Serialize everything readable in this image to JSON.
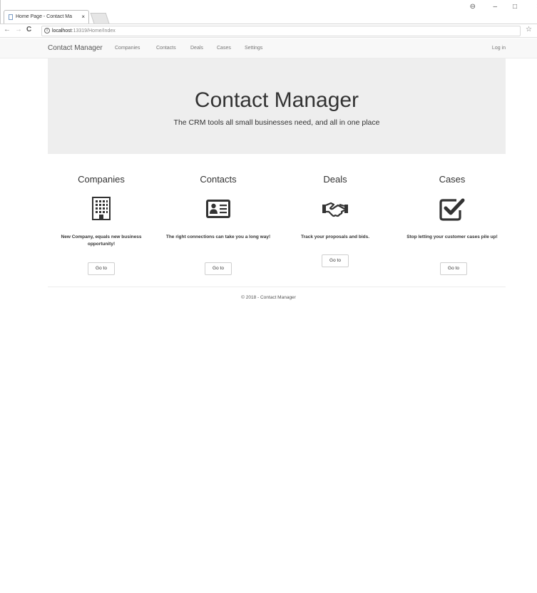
{
  "browser": {
    "tab_title": "Home Page - Contact Ma",
    "tab_close": "×",
    "url_host": "localhost",
    "url_rest": ":13319/Home/Index",
    "back": "←",
    "forward": "→",
    "reload": "C",
    "star": "☆",
    "win_account": "⊖",
    "win_min": "–",
    "win_max": "□",
    "win_close": "×"
  },
  "nav": {
    "brand": "Contact Manager",
    "links": [
      "Companies",
      "Contacts",
      "Deals",
      "Cases",
      "Settings"
    ],
    "login": "Log in"
  },
  "jumbotron": {
    "title": "Contact Manager",
    "subtitle": "The CRM tools all small businesses need, and all in one place"
  },
  "features": [
    {
      "title": "Companies",
      "icon": "building-icon",
      "desc": "New Company, equals new business opportunity!",
      "button": "Go to"
    },
    {
      "title": "Contacts",
      "icon": "id-card-icon",
      "desc": "The right connections can take you a long way!",
      "button": "Go to"
    },
    {
      "title": "Deals",
      "icon": "handshake-icon",
      "desc": "Track your proposals and bids.",
      "button": "Go to"
    },
    {
      "title": "Cases",
      "icon": "checkbox-icon",
      "desc": "Stop letting your customer cases pile up!",
      "button": "Go to"
    }
  ],
  "footer": "© 2018 - Contact Manager"
}
